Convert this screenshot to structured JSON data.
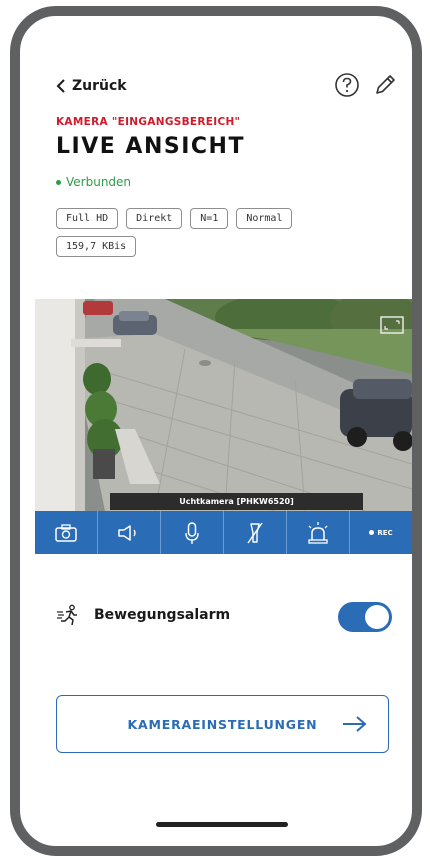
{
  "header": {
    "back_label": "Zurück",
    "subtitle": "KAMERA \"EINGANGSBEREICH\"",
    "title": "LIVE ANSICHT",
    "status": "Verbunden"
  },
  "chips": [
    "Full HD",
    "Direkt",
    "N=1",
    "Normal",
    "159,7 KBis"
  ],
  "video": {
    "camera_label": "Uchtkamera [PHKW6520]"
  },
  "toolbar": {
    "items": [
      "snapshot-icon",
      "speaker-icon",
      "microphone-icon",
      "light-off-icon",
      "siren-icon",
      "record-icon"
    ],
    "rec_label": "REC"
  },
  "motion_alarm": {
    "label": "Bewegungsalarm",
    "enabled": true
  },
  "settings_button": {
    "label": "KAMERAEINSTELLUNGEN"
  },
  "colors": {
    "accent": "#2a6cb5",
    "subtitle_red": "#d11a2a",
    "status_green": "#2e9c4a",
    "frame": "#5f6062"
  }
}
